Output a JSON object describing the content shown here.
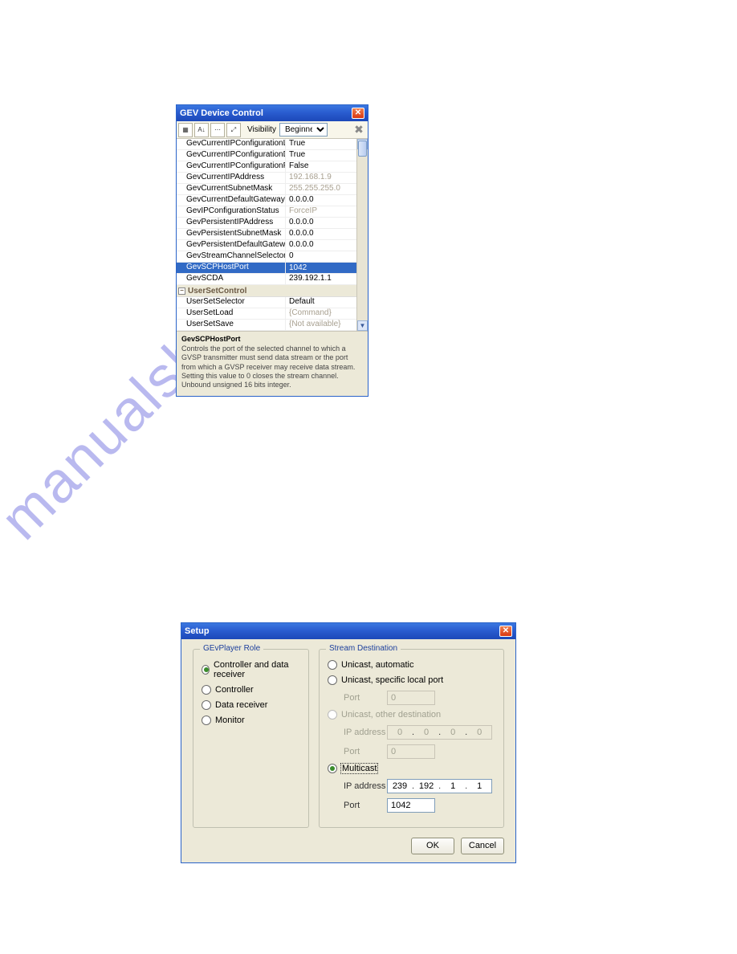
{
  "watermark": "manualshive.com",
  "gev_window": {
    "title": "GEV Device Control",
    "toolbar": {
      "visibility_label": "Visibility",
      "visibility_value": "Beginner"
    },
    "properties": [
      {
        "name": "GevCurrentIPConfigurationLLA",
        "value": "True",
        "dim": false
      },
      {
        "name": "GevCurrentIPConfigurationDHCP",
        "value": "True",
        "dim": false
      },
      {
        "name": "GevCurrentIPConfigurationPersistentIP",
        "value": "False",
        "dim": false
      },
      {
        "name": "GevCurrentIPAddress",
        "value": "192.168.1.9",
        "dim": true
      },
      {
        "name": "GevCurrentSubnetMask",
        "value": "255.255.255.0",
        "dim": true
      },
      {
        "name": "GevCurrentDefaultGateway",
        "value": "0.0.0.0",
        "dim": false
      },
      {
        "name": "GevIPConfigurationStatus",
        "value": "ForceIP",
        "dim": true
      },
      {
        "name": "GevPersistentIPAddress",
        "value": "0.0.0.0",
        "dim": false
      },
      {
        "name": "GevPersistentSubnetMask",
        "value": "0.0.0.0",
        "dim": false
      },
      {
        "name": "GevPersistentDefaultGateway",
        "value": "0.0.0.0",
        "dim": false
      },
      {
        "name": "GevStreamChannelSelector",
        "value": "0",
        "dim": false
      },
      {
        "name": "GevSCPHostPort",
        "value": "1042",
        "dim": false,
        "selected": true,
        "spinner": true
      },
      {
        "name": "GevSCDA",
        "value": "239.192.1.1",
        "dim": false
      }
    ],
    "category": {
      "label": "UserSetControl",
      "rows": [
        {
          "name": "UserSetSelector",
          "value": "Default",
          "dim": false
        },
        {
          "name": "UserSetLoad",
          "value": "{Command}",
          "dim": true
        },
        {
          "name": "UserSetSave",
          "value": "{Not available}",
          "dim": true
        }
      ]
    },
    "description": {
      "title": "GevSCPHostPort",
      "body": "Controls the port of the selected channel to which a GVSP transmitter must send data stream or the port from which a GVSP receiver may receive data stream. Setting this value to 0 closes the stream channel. Unbound unsigned 16 bits integer."
    }
  },
  "setup_window": {
    "title": "Setup",
    "role_group": {
      "legend": "GEvPlayer Role",
      "options": [
        {
          "label": "Controller and data receiver",
          "checked": true
        },
        {
          "label": "Controller",
          "checked": false
        },
        {
          "label": "Data receiver",
          "checked": false
        },
        {
          "label": "Monitor",
          "checked": false
        }
      ]
    },
    "stream_group": {
      "legend": "Stream Destination",
      "unicast_auto": "Unicast, automatic",
      "unicast_specific": "Unicast, specific local port",
      "unicast_specific_port": "0",
      "unicast_other": "Unicast, other destination",
      "unicast_other_ip": [
        "0",
        "0",
        "0",
        "0"
      ],
      "unicast_other_port": "0",
      "multicast": "Multicast",
      "multicast_ip": [
        "239",
        "192",
        "1",
        "1"
      ],
      "multicast_port": "1042",
      "label_port": "Port",
      "label_ip": "IP address"
    },
    "buttons": {
      "ok": "OK",
      "cancel": "Cancel"
    }
  }
}
